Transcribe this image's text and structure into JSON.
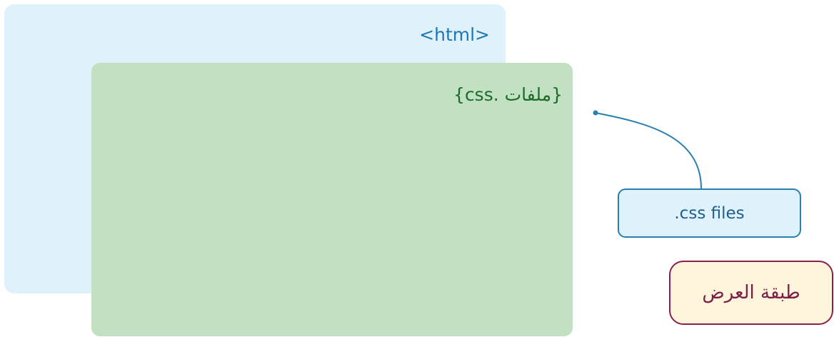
{
  "diagram": {
    "html_panel": {
      "label": "<html>"
    },
    "css_panel": {
      "label": "{ملفات .css}"
    },
    "callout": {
      "label": ".css files"
    },
    "layer": {
      "label": "طبقة العرض"
    }
  },
  "colors": {
    "html_panel_bg": "#dff1fa",
    "css_panel_bg": "#c2e1c2",
    "html_text": "#1f77b4",
    "css_text": "#1d6b2a",
    "callout_border": "#2a7fb0",
    "layer_bg": "#fff4dc",
    "layer_border": "#8a214b"
  }
}
